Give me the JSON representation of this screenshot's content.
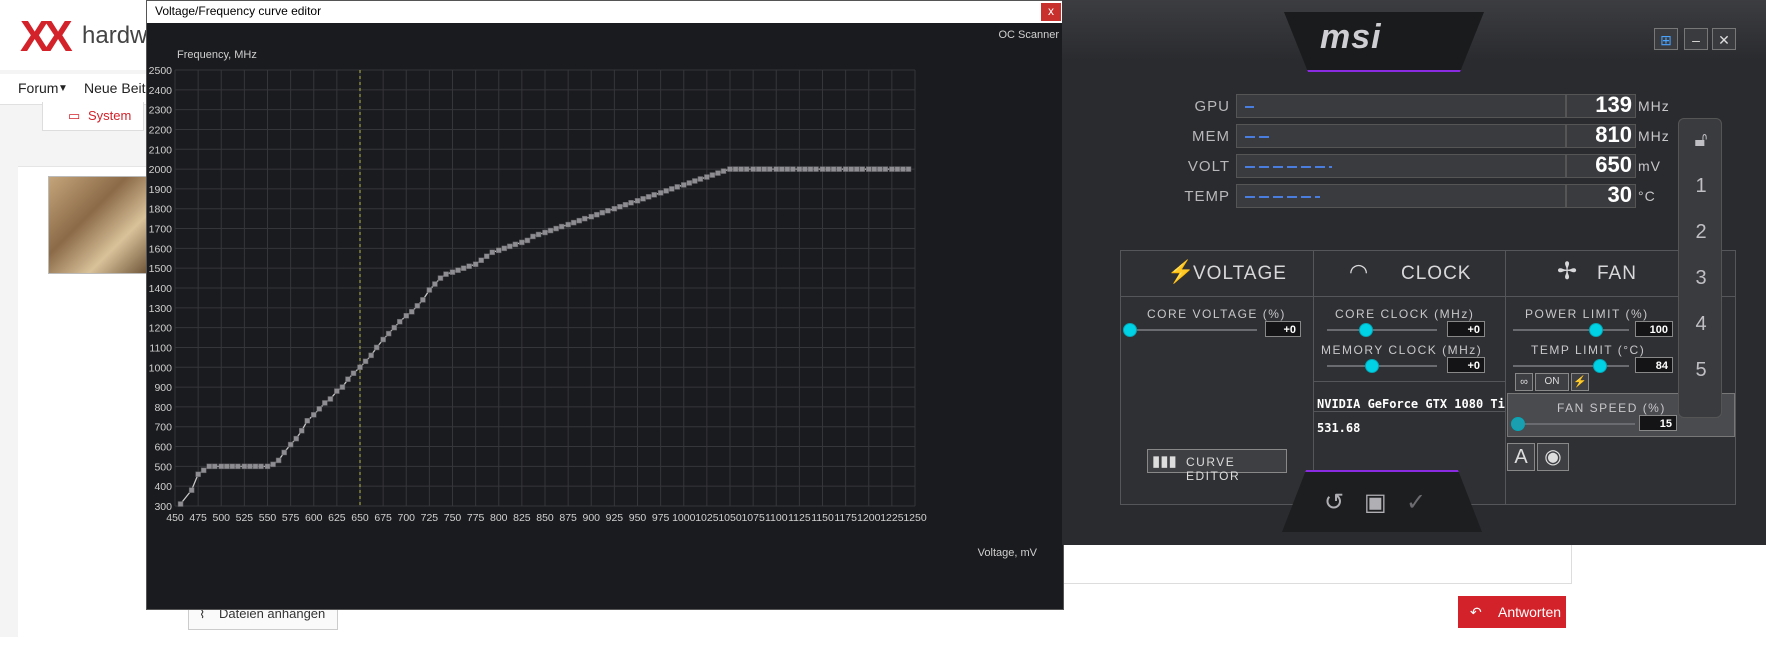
{
  "background_page": {
    "logo": "XX",
    "brand": "hardwa",
    "nav": [
      "Forum",
      "Neue Beitr"
    ],
    "system_label": "System",
    "attach_label": "Dateien anhängen",
    "reply_label": "Antworten"
  },
  "curve_editor": {
    "title": "Voltage/Frequency curve editor",
    "close_label": "x",
    "oc_scanner_label": "OC Scanner",
    "chart_data": {
      "type": "line",
      "title": "",
      "xlabel": "Voltage, mV",
      "ylabel": "Frequency, MHz",
      "xlim": [
        450,
        1250
      ],
      "ylim": [
        300,
        2500
      ],
      "x_ticks": [
        450,
        475,
        500,
        525,
        550,
        575,
        600,
        625,
        650,
        675,
        700,
        725,
        750,
        775,
        800,
        825,
        850,
        875,
        900,
        925,
        950,
        975,
        1000,
        1025,
        1050,
        1075,
        1100,
        1125,
        1150,
        1175,
        1200,
        1225,
        1250
      ],
      "y_ticks": [
        300,
        400,
        500,
        600,
        700,
        800,
        900,
        1000,
        1100,
        1200,
        1300,
        1400,
        1500,
        1600,
        1700,
        1800,
        1900,
        2000,
        2100,
        2200,
        2300,
        2400,
        2500
      ],
      "current_voltage_marker": 650,
      "grid": true,
      "series": [
        {
          "x": [
            456,
            468,
            475,
            481,
            487,
            493,
            500,
            506,
            512,
            518,
            525,
            531,
            537,
            543,
            550,
            556,
            562,
            568,
            575,
            581,
            587,
            593,
            600,
            606,
            612,
            618,
            625,
            631,
            637,
            643,
            650,
            656,
            662,
            668,
            675,
            681,
            687,
            693,
            700,
            706,
            712,
            718,
            725,
            731,
            737,
            743,
            750,
            756,
            762,
            768,
            775,
            781,
            787,
            793,
            800,
            806,
            812,
            818,
            825,
            831,
            837,
            843,
            850,
            856,
            862,
            868,
            875,
            881,
            887,
            893,
            900,
            906,
            912,
            918,
            925,
            931,
            937,
            943,
            950,
            956,
            962,
            968,
            975,
            981,
            987,
            993,
            1000,
            1006,
            1012,
            1018,
            1025,
            1031,
            1037,
            1043,
            1050,
            1056,
            1062,
            1068,
            1075,
            1081,
            1087,
            1093,
            1100,
            1106,
            1112,
            1118,
            1125,
            1131,
            1137,
            1143,
            1150,
            1156,
            1162,
            1168,
            1175,
            1181,
            1187,
            1193,
            1200,
            1206,
            1212,
            1218,
            1225,
            1231,
            1237,
            1243
          ],
          "y": [
            310,
            380,
            460,
            480,
            500,
            500,
            500,
            500,
            500,
            500,
            500,
            500,
            500,
            500,
            500,
            510,
            530,
            570,
            610,
            640,
            680,
            730,
            760,
            790,
            820,
            840,
            880,
            900,
            940,
            970,
            1000,
            1030,
            1060,
            1100,
            1140,
            1170,
            1200,
            1230,
            1260,
            1280,
            1310,
            1340,
            1390,
            1420,
            1450,
            1470,
            1480,
            1490,
            1500,
            1510,
            1520,
            1540,
            1560,
            1580,
            1590,
            1600,
            1610,
            1620,
            1630,
            1640,
            1660,
            1670,
            1680,
            1690,
            1700,
            1710,
            1720,
            1730,
            1740,
            1750,
            1760,
            1770,
            1780,
            1790,
            1800,
            1810,
            1820,
            1830,
            1840,
            1850,
            1860,
            1870,
            1880,
            1890,
            1900,
            1910,
            1920,
            1930,
            1940,
            1950,
            1960,
            1970,
            1980,
            1990,
            2000,
            2000,
            2000,
            2000,
            2000,
            2000,
            2000,
            2000,
            2000,
            2000,
            2000,
            2000,
            2000,
            2000,
            2000,
            2000,
            2000,
            2000,
            2000,
            2000,
            2000,
            2000,
            2000,
            2000,
            2000,
            2000,
            2000,
            2000,
            2000,
            2000,
            2000,
            2000
          ]
        }
      ]
    }
  },
  "afterburner": {
    "logo": "msi",
    "monitor": [
      {
        "label": "GPU",
        "value": "139",
        "unit": "MHz",
        "fill": 0.03
      },
      {
        "label": "MEM",
        "value": "810",
        "unit": "MHz",
        "fill": 0.08
      },
      {
        "label": "VOLT",
        "value": "650",
        "unit": "mV",
        "fill": 0.28
      },
      {
        "label": "TEMP",
        "value": "30",
        "unit": "°C",
        "fill": 0.24
      }
    ],
    "voltage": {
      "header": "VOLTAGE",
      "core_voltage_label": "CORE VOLTAGE (%)",
      "core_voltage_value": "+0",
      "curve_editor_label": "CURVE EDITOR"
    },
    "clock": {
      "header": "CLOCK",
      "core_clock_label": "CORE CLOCK (MHz)",
      "core_clock_value": "+0",
      "memory_clock_label": "MEMORY CLOCK (MHz)",
      "memory_clock_value": "+0",
      "gpu_name": "NVIDIA GeForce GTX 1080 Ti",
      "driver": "531.68"
    },
    "fan": {
      "header": "FAN",
      "power_limit_label": "POWER LIMIT (%)",
      "power_limit_value": "100",
      "temp_limit_label": "TEMP LIMIT (°C)",
      "temp_limit_value": "84",
      "link_on_label": "ON",
      "fan_speed_label": "FAN SPEED (%)",
      "fan_speed_value": "15",
      "auto_label": "A"
    },
    "profiles": [
      "1",
      "2",
      "3",
      "4",
      "5"
    ]
  },
  "colors": {
    "accent": "#00d2e6",
    "logo_red": "#d3222a",
    "purple": "#8a2be2"
  }
}
